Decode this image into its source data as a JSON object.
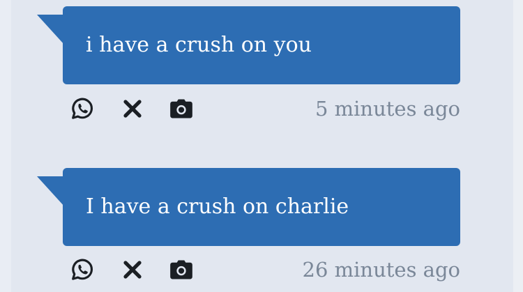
{
  "messages": [
    {
      "text": "i have a crush on you",
      "time": "5 minutes ago",
      "actions": [
        "whatsapp-icon",
        "close-icon",
        "camera-icon"
      ]
    },
    {
      "text": "I have a crush on charlie",
      "time": "26 minutes ago",
      "actions": [
        "whatsapp-icon",
        "close-icon",
        "camera-icon"
      ]
    }
  ],
  "colors": {
    "bubble": "#2d6db3",
    "bubble_text": "#ffffff",
    "background": "#e2e7f0",
    "timestamp": "#7a8798",
    "icon": "#1b1f24"
  }
}
